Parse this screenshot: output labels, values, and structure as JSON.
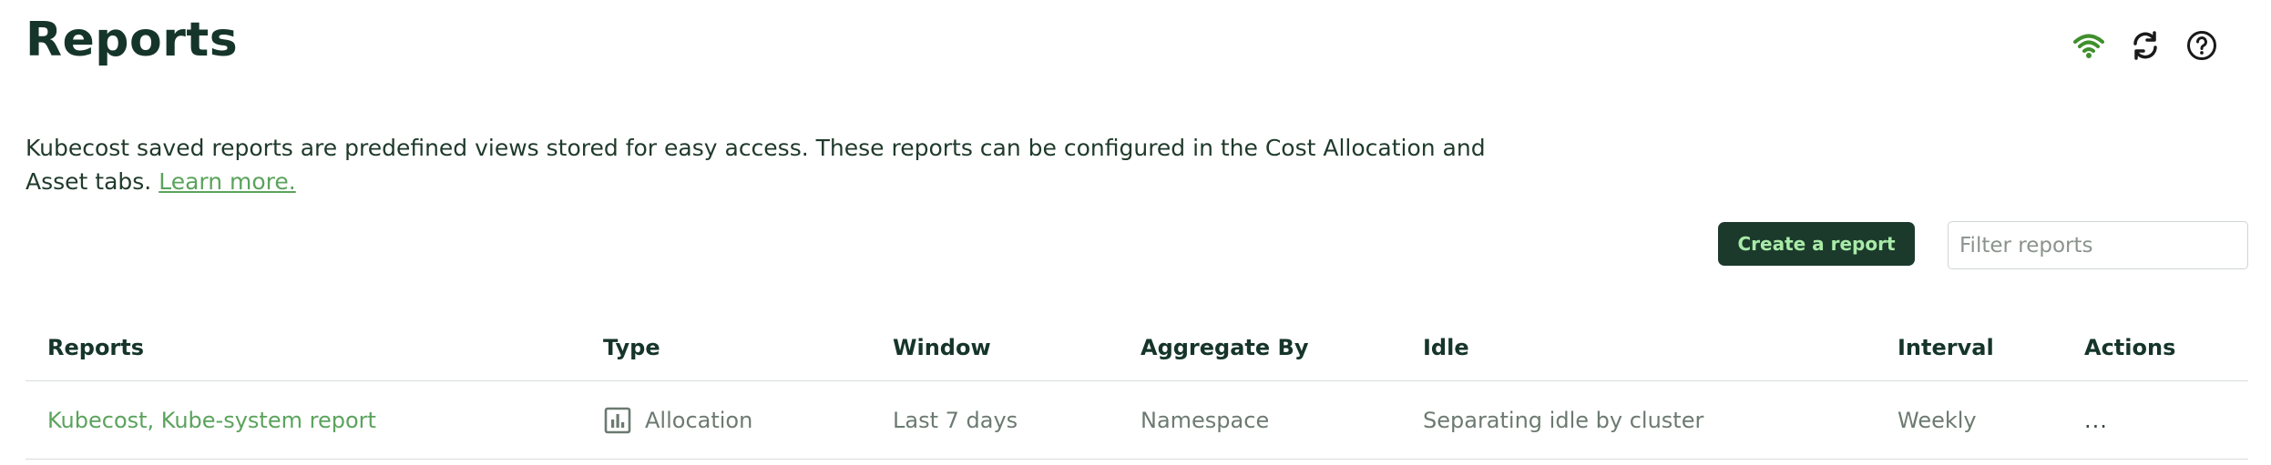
{
  "page": {
    "title": "Reports"
  },
  "header_icons": [
    {
      "name": "wifi-icon",
      "color": "#3f8f2c"
    },
    {
      "name": "refresh-icon",
      "color": "#1a1a1a"
    },
    {
      "name": "help-icon",
      "color": "#1a1a1a"
    }
  ],
  "description": {
    "text": "Kubecost saved reports are predefined views stored for easy access. These reports can be configured in the Cost Allocation and Asset tabs. ",
    "link_label": "Learn more."
  },
  "toolbar": {
    "create_label": "Create a report",
    "filter_placeholder": "Filter reports",
    "filter_value": ""
  },
  "table": {
    "headers": {
      "reports": "Reports",
      "type": "Type",
      "window": "Window",
      "aggregate": "Aggregate By",
      "idle": "Idle",
      "interval": "Interval",
      "actions": "Actions"
    },
    "rows": [
      {
        "report": "Kubecost, Kube-system report",
        "type_icon": "bar-chart-icon",
        "type": "Allocation",
        "window": "Last 7 days",
        "aggregate": "Namespace",
        "idle": "Separating idle by cluster",
        "interval": "Weekly",
        "actions": "..."
      }
    ]
  },
  "colors": {
    "accent": "#5ba35c",
    "primary_button": "#1b3a2b",
    "primary_button_text": "#a9eaa8",
    "heading": "#16352a"
  }
}
